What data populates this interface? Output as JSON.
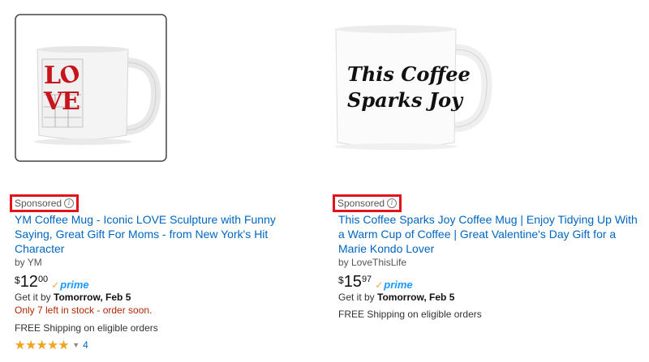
{
  "products": [
    {
      "sponsored": "Sponsored",
      "title": "YM Coffee Mug - Iconic LOVE Sculpture with Funny Saying, Great Gift For Moms - from New York's Hit Character",
      "brand": "by YM",
      "price_symbol": "$",
      "price_whole": "12",
      "price_fraction": "00",
      "prime": "prime",
      "delivery_prefix": "Get it by ",
      "delivery_date": "Tomorrow, Feb 5",
      "stock_notice": "Only 7 left in stock - order soon.",
      "shipping": "FREE Shipping on eligible orders",
      "rating_stars": "★★★★★",
      "review_count": "4",
      "mug_art": "LOVE"
    },
    {
      "sponsored": "Sponsored",
      "title": "This Coffee Sparks Joy Coffee Mug | Enjoy Tidying Up With a Warm Cup of Coffee | Great Valentine's Day Gift for a Marie Kondo Lover",
      "brand": "by LoveThisLife",
      "price_symbol": "$",
      "price_whole": "15",
      "price_fraction": "97",
      "prime": "prime",
      "delivery_prefix": "Get it by ",
      "delivery_date": "Tomorrow, Feb 5",
      "shipping": "FREE Shipping on eligible orders",
      "mug_line1": "This Coffee",
      "mug_line2": "Sparks Joy"
    }
  ],
  "colors": {
    "link": "#0066c0",
    "sponsored_border": "#e1141c",
    "stock": "#b12704",
    "prime": "#1a98ff",
    "star": "#f4a41c"
  }
}
